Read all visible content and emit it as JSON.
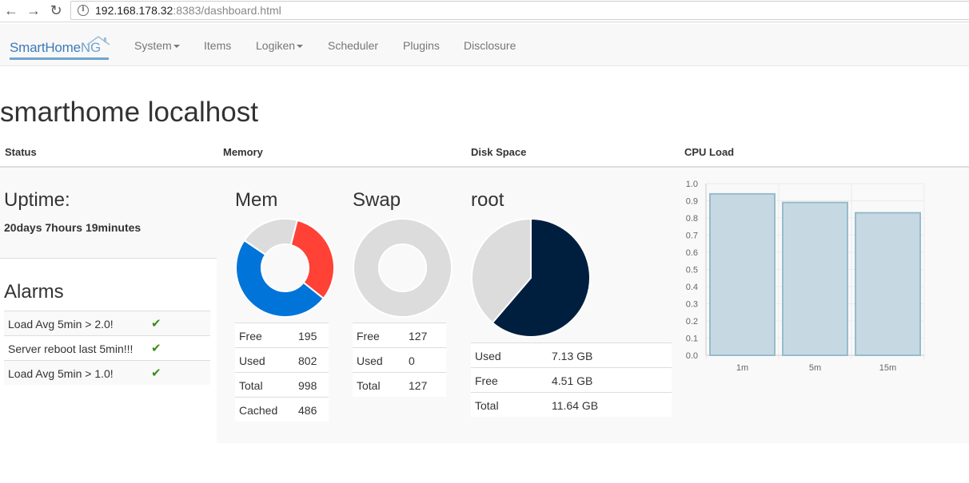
{
  "browser": {
    "url_host": "192.168.178.32",
    "url_rest": ":8383/dashboard.html"
  },
  "navbar": {
    "brand_main": "SmartHome",
    "brand_ng": "NG",
    "items": [
      {
        "label": "System",
        "dropdown": true
      },
      {
        "label": "Items",
        "dropdown": false
      },
      {
        "label": "Logiken",
        "dropdown": true
      },
      {
        "label": "Scheduler",
        "dropdown": false
      },
      {
        "label": "Plugins",
        "dropdown": false
      },
      {
        "label": "Disclosure",
        "dropdown": false
      }
    ]
  },
  "page_title": "smarthome localhost",
  "sections": {
    "status": "Status",
    "memory": "Memory",
    "disk": "Disk Space",
    "cpu": "CPU Load"
  },
  "status": {
    "uptime_label": "Uptime:",
    "uptime_value": "20days 7hours 19minutes",
    "alarms_label": "Alarms",
    "alarms": [
      {
        "text": "Load Avg 5min > 2.0!",
        "ok": true
      },
      {
        "text": "Server reboot last 5min!!!",
        "ok": true
      },
      {
        "text": "Load Avg 5min > 1.0!",
        "ok": true
      }
    ]
  },
  "memory": {
    "mem": {
      "title": "Mem",
      "rows": [
        {
          "label": "Free",
          "value": "195"
        },
        {
          "label": "Used",
          "value": "802"
        },
        {
          "label": "Total",
          "value": "998"
        },
        {
          "label": "Cached",
          "value": "486"
        }
      ]
    },
    "swap": {
      "title": "Swap",
      "rows": [
        {
          "label": "Free",
          "value": "127"
        },
        {
          "label": "Used",
          "value": "0"
        },
        {
          "label": "Total",
          "value": "127"
        }
      ]
    }
  },
  "disk": {
    "title": "root",
    "rows": [
      {
        "label": "Used",
        "value": "7.13 GB"
      },
      {
        "label": "Free",
        "value": "4.51 GB"
      },
      {
        "label": "Total",
        "value": "11.64 GB"
      }
    ]
  },
  "colors": {
    "mem_free": "#dcdcdc",
    "mem_used": "#ff4136",
    "mem_cached": "#0074d9",
    "swap_free": "#dcdcdc",
    "disk_used": "#001f3f",
    "disk_free": "#dcdcdc",
    "cpu_bar_fill": "#c6d9e3",
    "cpu_bar_stroke": "#97bbcd",
    "check": "#3c8c1a"
  },
  "chart_data": [
    {
      "type": "pie",
      "name": "Mem",
      "hole": true,
      "labels": [
        "Free",
        "Used",
        "Cached"
      ],
      "values": [
        195,
        316,
        486
      ]
    },
    {
      "type": "pie",
      "name": "Swap",
      "hole": true,
      "labels": [
        "Free",
        "Used"
      ],
      "values": [
        127,
        0
      ]
    },
    {
      "type": "pie",
      "name": "root",
      "hole": false,
      "labels": [
        "Used",
        "Free"
      ],
      "values": [
        7.13,
        4.51
      ]
    },
    {
      "type": "bar",
      "categories": [
        "1m",
        "5m",
        "15m"
      ],
      "values": [
        0.94,
        0.89,
        0.83
      ],
      "ylim": [
        0,
        1.0
      ],
      "yticks": [
        "0.0",
        "0.1",
        "0.2",
        "0.3",
        "0.4",
        "0.5",
        "0.6",
        "0.7",
        "0.8",
        "0.9",
        "1.0"
      ],
      "grid": true
    }
  ]
}
